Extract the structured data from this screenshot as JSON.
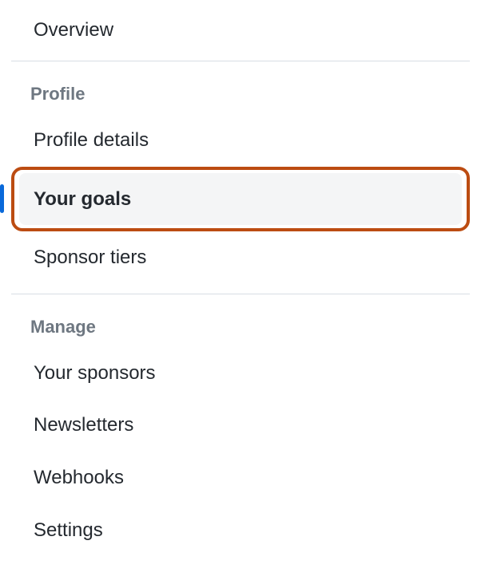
{
  "overview": {
    "label": "Overview"
  },
  "sections": [
    {
      "header": "Profile",
      "items": [
        {
          "label": "Profile details",
          "selected": false
        },
        {
          "label": "Your goals",
          "selected": true,
          "highlighted": true
        },
        {
          "label": "Sponsor tiers",
          "selected": false
        }
      ]
    },
    {
      "header": "Manage",
      "items": [
        {
          "label": "Your sponsors",
          "selected": false
        },
        {
          "label": "Newsletters",
          "selected": false
        },
        {
          "label": "Webhooks",
          "selected": false
        },
        {
          "label": "Settings",
          "selected": false
        }
      ]
    }
  ]
}
